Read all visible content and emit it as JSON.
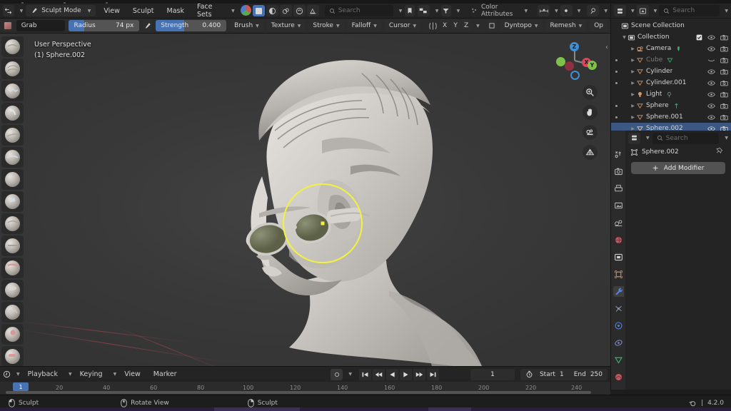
{
  "app": {
    "version_label": "4.2.0"
  },
  "viewport_header": {
    "editor_icon": "editor-type-icon",
    "mode": "Sculpt Mode",
    "menus": [
      "View",
      "Sculpt",
      "Mask",
      "Face Sets"
    ],
    "shading_icons": [
      "material-preview-orb",
      "solid-shading",
      "xray-toggle",
      "overlays-toggle",
      "sculpt-options"
    ],
    "search_placeholder": "Search"
  },
  "tool_settings": {
    "brush_icon": "brush-swatch-icon",
    "brush_name": "Grab",
    "radius_label": "Radius",
    "radius_value": "74 px",
    "radius_fill_pct": 22,
    "pressure_icon": "pen-pressure-icon",
    "strength_label": "Strength",
    "strength_value": "0.400",
    "strength_fill_pct": 40,
    "dropdowns": [
      "Brush",
      "Texture",
      "Stroke",
      "Falloff",
      "Cursor"
    ],
    "symmetry_icon": "symmetry-icon",
    "symmetry_axes": [
      "X",
      "Y",
      "Z"
    ],
    "mask_box_icon": "mask-box-icon",
    "dyntopo": "Dyntopo",
    "remesh": "Remesh",
    "options": "Op"
  },
  "viewport": {
    "perspective_label": "User Perspective",
    "object_label": "(1) Sphere.002",
    "collapse_icon": "collapse-sidebar-icon",
    "gizmo": {
      "axes": [
        "Z",
        "X",
        "Y"
      ]
    },
    "nav_buttons": [
      "zoom-icon",
      "pan-hand-icon",
      "camera-view-icon",
      "orthographic-grid-icon"
    ],
    "brush_cursor": "brush-circle-cursor",
    "brush_count": 17,
    "selected_brush_index": 15
  },
  "timeline": {
    "editor_icon": "timeline-editor-icon",
    "menus": [
      "Playback",
      "Keying",
      "View",
      "Marker"
    ],
    "record_icon": "auto-keying-icon",
    "transport_icons": [
      "jump-start-icon",
      "prev-keyframe-icon",
      "play-reverse-icon",
      "play-icon",
      "next-keyframe-icon",
      "jump-end-icon"
    ],
    "current_frame": "1",
    "clock_icon": "frame-range-icon",
    "start_label": "Start",
    "start_value": "1",
    "end_label": "End",
    "end_value": "250",
    "ruler_ticks": [
      "20",
      "40",
      "60",
      "80",
      "100",
      "120",
      "140",
      "160",
      "180",
      "200",
      "220",
      "240"
    ],
    "playhead_frame": "1"
  },
  "outliner": {
    "display_mode_icon": "outliner-display-mode-icon",
    "filter_icon": "outliner-filter-icon",
    "search_placeholder": "Search",
    "root": {
      "name": "Scene Collection",
      "icon": "scene-collection-icon"
    },
    "collection": {
      "name": "Collection",
      "icon": "collection-icon",
      "checkbox": true
    },
    "items": [
      {
        "name": "Camera",
        "icon": "camera-object-icon",
        "data_icon": "camera-data-icon",
        "eye": "open",
        "render": true,
        "dot": false,
        "dim": false
      },
      {
        "name": "Cube",
        "icon": "mesh-object-icon",
        "data_icon": "mesh-data-icon",
        "eye": "closed",
        "render": true,
        "dot": true,
        "dim": true
      },
      {
        "name": "Cylinder",
        "icon": "mesh-object-icon",
        "data_icon": "",
        "eye": "open",
        "render": true,
        "dot": true,
        "dim": false
      },
      {
        "name": "Cylinder.001",
        "icon": "mesh-object-icon",
        "data_icon": "",
        "eye": "open",
        "render": true,
        "dot": true,
        "dim": false
      },
      {
        "name": "Light",
        "icon": "light-object-icon",
        "data_icon": "light-data-icon",
        "eye": "open",
        "render": true,
        "dot": false,
        "dim": false
      },
      {
        "name": "Sphere",
        "icon": "mesh-object-icon",
        "data_icon": "mesh-data-icon",
        "eye": "open",
        "render": true,
        "dot": true,
        "dim": false
      },
      {
        "name": "Sphere.001",
        "icon": "mesh-object-icon",
        "data_icon": "",
        "eye": "open",
        "render": true,
        "dot": true,
        "dim": false
      },
      {
        "name": "Sphere.002",
        "icon": "mesh-object-icon",
        "data_icon": "",
        "eye": "open",
        "render": true,
        "dot": false,
        "dim": false,
        "selected": true
      }
    ]
  },
  "properties": {
    "editor_icon": "properties-editor-icon",
    "search_placeholder": "Search",
    "tabs": [
      {
        "name": "tool",
        "icon": "tool-tab-icon",
        "color": "#b6b6b6"
      },
      {
        "name": "render",
        "icon": "render-tab-icon",
        "color": "#b6b6b6"
      },
      {
        "name": "output",
        "icon": "output-tab-icon",
        "color": "#b6b6b6"
      },
      {
        "name": "view-layer",
        "icon": "view-layer-tab-icon",
        "color": "#b6b6b6"
      },
      {
        "name": "scene",
        "icon": "scene-tab-icon",
        "color": "#b6b6b6"
      },
      {
        "name": "world",
        "icon": "world-tab-icon",
        "color": "#c0585f"
      },
      {
        "name": "collection",
        "icon": "collection-tab-icon",
        "color": "#cfcfcf"
      },
      {
        "name": "object",
        "icon": "object-tab-icon",
        "color": "#d88f4a"
      },
      {
        "name": "modifier",
        "icon": "wrench-tab-icon",
        "color": "#5a85d6",
        "selected": true
      },
      {
        "name": "particles",
        "icon": "particles-tab-icon",
        "color": "#8fa4c4"
      },
      {
        "name": "physics",
        "icon": "physics-tab-icon",
        "color": "#5a85d6"
      },
      {
        "name": "constraints",
        "icon": "constraints-tab-icon",
        "color": "#7b8fd6"
      },
      {
        "name": "data",
        "icon": "object-data-tab-icon",
        "color": "#3fae72"
      },
      {
        "name": "material",
        "icon": "material-tab-icon",
        "color": "#c0585f"
      }
    ],
    "breadcrumb_icon": "object-breadcrumb-icon",
    "breadcrumb_name": "Sphere.002",
    "pin_icon": "pin-icon",
    "add_modifier_label": "Add Modifier",
    "add_modifier_icon": "plus-icon"
  },
  "status_bar": {
    "items": [
      {
        "icon": "mouse-left-icon",
        "label": "Sculpt"
      },
      {
        "icon": "mouse-middle-icon",
        "label": "Rotate View"
      },
      {
        "icon": "mouse-right-icon",
        "label": "Sculpt"
      }
    ],
    "blender_icon": "blender-logo-icon",
    "separator": "|",
    "version": "4.2.0"
  },
  "colors": {
    "accent_blue": "#4772b3",
    "brush_cursor_yellow": "#f2f23d",
    "selection_blue": "#3b5782",
    "panel_bg": "#242424",
    "viewport_bg": "#3b3b3b"
  }
}
